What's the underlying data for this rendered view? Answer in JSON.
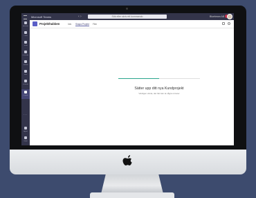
{
  "titlebar": {
    "app_name": "Microsoft Teams",
    "search_placeholder": "Sök eller skriv ett kommando",
    "tenant": "Bluebeam AB"
  },
  "rail": [
    {
      "label": "Aktivitet",
      "icon": "bell-icon"
    },
    {
      "label": "Chatt",
      "icon": "chat-icon"
    },
    {
      "label": "Team",
      "icon": "team-icon"
    },
    {
      "label": "Kalender",
      "icon": "calendar-icon"
    },
    {
      "label": "Samtal",
      "icon": "phone-icon"
    },
    {
      "label": "Filer",
      "icon": "file-icon"
    },
    {
      "label": "Planner",
      "icon": "planner-icon"
    },
    {
      "label": "Projekt",
      "icon": "project-icon"
    },
    {
      "label": "Appar",
      "icon": "apps-icon"
    },
    {
      "label": "Hjälp",
      "icon": "help-icon"
    }
  ],
  "header": {
    "channel": "Projekthubben",
    "tabs": [
      "Info",
      "Skapa Projekt",
      "Filer"
    ],
    "active_tab": "Skapa Projekt"
  },
  "status": {
    "title": "Sätter upp ditt nya Kundprojekt",
    "subtitle": "Vänligen vänta, det här kan ta några minuter",
    "progress": 0.5
  },
  "colors": {
    "frame": "#33344a",
    "accent": "#6264a7",
    "progress": "#2aa58c"
  }
}
